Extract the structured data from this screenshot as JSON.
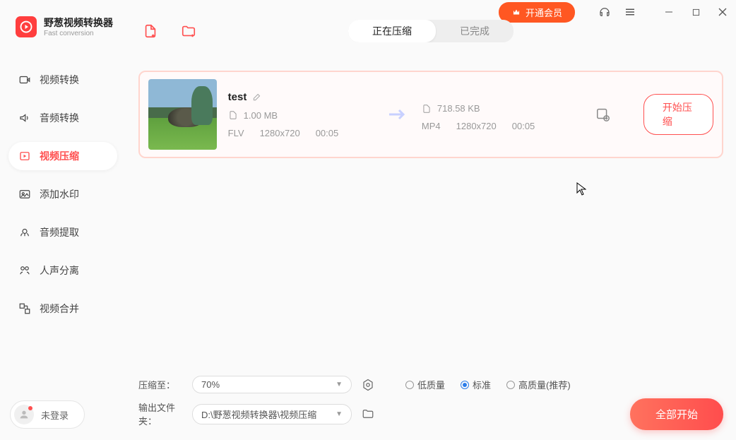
{
  "app": {
    "title": "野葱视频转换器",
    "subtitle": "Fast conversion"
  },
  "titlebar": {
    "vip_label": "开通会员"
  },
  "sidebar": {
    "items": [
      {
        "label": "视频转换"
      },
      {
        "label": "音频转换"
      },
      {
        "label": "视频压缩"
      },
      {
        "label": "添加水印"
      },
      {
        "label": "音频提取"
      },
      {
        "label": "人声分离"
      },
      {
        "label": "视频合并"
      }
    ]
  },
  "user": {
    "status": "未登录"
  },
  "tabs": {
    "active": "正在压缩",
    "inactive": "已完成"
  },
  "files": [
    {
      "name": "test",
      "src_size": "1.00 MB",
      "src_format": "FLV",
      "src_res": "1280x720",
      "src_dur": "00:05",
      "out_size": "718.58 KB",
      "out_format": "MP4",
      "out_res": "1280x720",
      "out_dur": "00:05",
      "action": "开始压缩"
    }
  ],
  "bottom": {
    "compress_label": "压缩至：",
    "compress_value": "70%",
    "output_label": "输出文件夹：",
    "output_path": "D:\\野葱视频转换器\\视频压缩",
    "quality": {
      "low": "低质量",
      "standard": "标准",
      "high": "高质量(推荐)"
    },
    "start_all": "全部开始"
  }
}
